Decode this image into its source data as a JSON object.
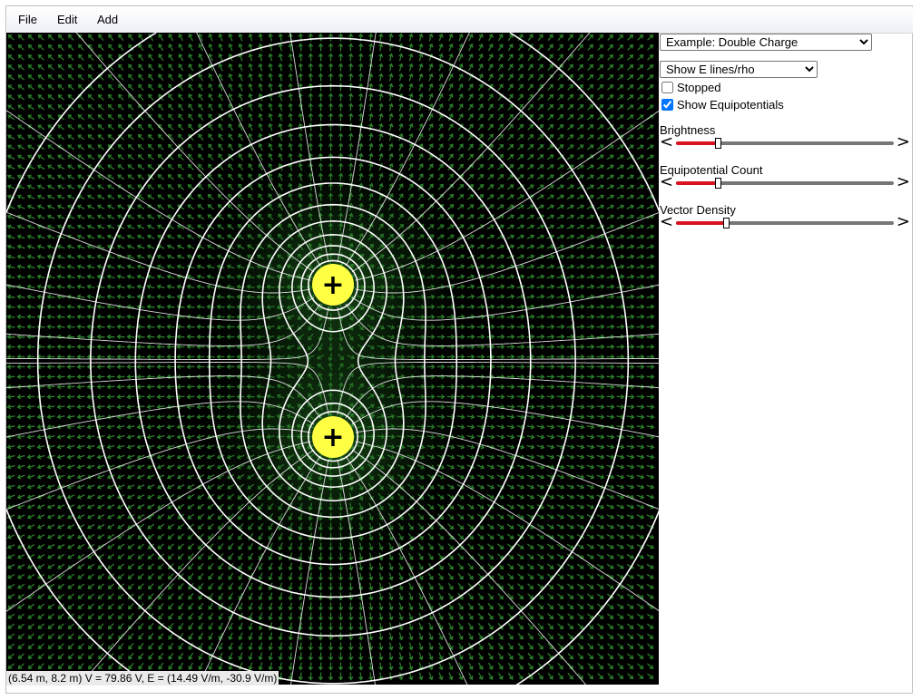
{
  "menu": {
    "file": "File",
    "edit": "Edit",
    "add": "Add"
  },
  "panel": {
    "example_select": {
      "selected": "Example: Double Charge",
      "options": [
        "Example: Double Charge"
      ]
    },
    "display_select": {
      "selected": "Show E lines/rho",
      "options": [
        "Show E lines/rho"
      ]
    },
    "stopped": {
      "label": "Stopped",
      "checked": false
    },
    "show_equipotentials": {
      "label": "Show Equipotentials",
      "checked": true
    },
    "sliders": [
      {
        "label": "Brightness",
        "value": 0.19
      },
      {
        "label": "Equipotential Count",
        "value": 0.19
      },
      {
        "label": "Vector Density",
        "value": 0.23
      }
    ],
    "arrow_left": "<",
    "arrow_right": ">"
  },
  "simulation": {
    "charges": [
      {
        "symbol": "+",
        "x": 0.0,
        "y": 1.0
      },
      {
        "symbol": "+",
        "x": 0.0,
        "y": -1.0
      }
    ],
    "charge_color": "#ffff44",
    "field_color": "#3aa83a",
    "line_color": "#ffffff",
    "background_color": "#000000"
  },
  "status": {
    "text": "(6.54 m, 8.2 m) V = 79.86 V, E = (14.49 V/m, -30.9 V/m)"
  }
}
